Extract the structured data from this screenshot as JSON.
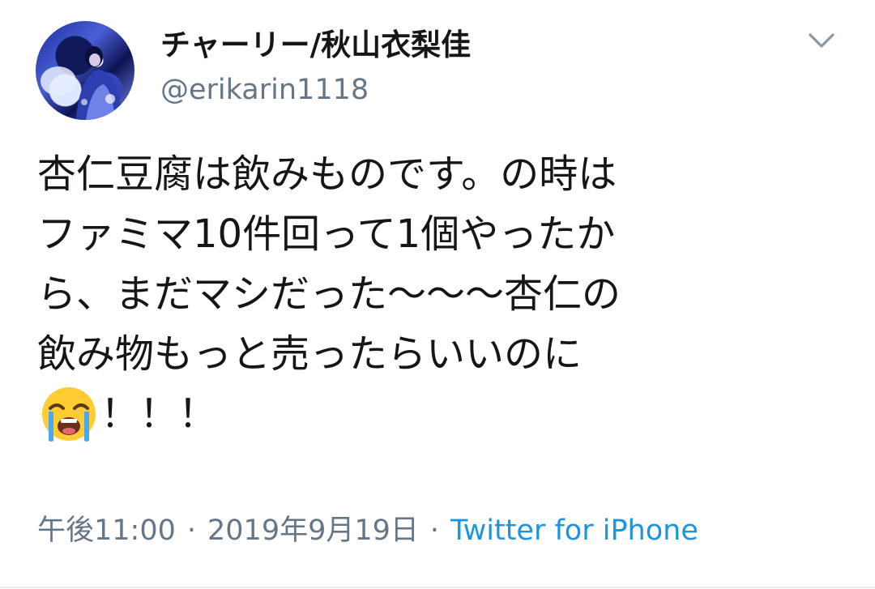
{
  "user": {
    "display_name": "チャーリー/秋山衣梨佳",
    "handle": "@erikarin1118",
    "avatar_icon": "profile-photo"
  },
  "menu": {
    "icon": "chevron-down-icon"
  },
  "tweet": {
    "lines": [
      "杏仁豆腐は飲みものです。の時は",
      "ファミマ10件回って1個やったか",
      "ら、まだマシだった〜〜〜杏仁の",
      "飲み物もっと売ったらいいのに",
      "！！！"
    ],
    "emoji": "loudly-crying-face"
  },
  "meta": {
    "time": "午後11:00",
    "date": "2019年9月19日",
    "separator": "·",
    "source": "Twitter for iPhone"
  },
  "colors": {
    "text": "#14171a",
    "muted": "#657786",
    "link": "#1b95e0"
  }
}
